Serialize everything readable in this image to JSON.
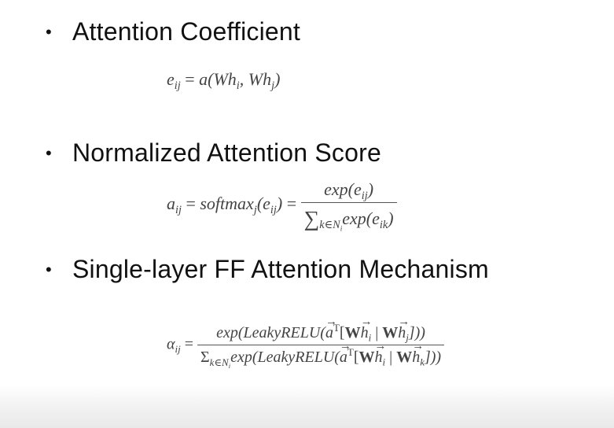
{
  "bullets": [
    {
      "symbol": "•",
      "text": "Attention Coefficient"
    },
    {
      "symbol": "•",
      "text": "Normalized Attention Score"
    },
    {
      "symbol": "•",
      "text": "Single-layer FF Attention Mechanism"
    }
  ],
  "eq1": {
    "lhs": "e",
    "lhs_sub": "ij",
    "rhs": "a(Wh",
    "arg1_sub": "i",
    "sep": ", Wh",
    "arg2_sub": "j",
    "close": ")",
    "equals": " = "
  },
  "eq2": {
    "lhs": "a",
    "lhs_sub": "ij",
    "equals": " = ",
    "softmax": "softmax",
    "softmax_sub": "j",
    "softmax_arg": "(e",
    "softmax_arg_sub": "ij",
    "softmax_close": ")",
    "equals2": " = ",
    "num": "exp(e",
    "num_sub": "ij",
    "num_close": ")",
    "den_sigma": "∑",
    "den_sigma_sub": "k∈N",
    "den_sigma_subsub": "i",
    "den": "exp(e",
    "den_sub": "ik",
    "den_close": ")"
  },
  "eq3": {
    "lhs": "α",
    "lhs_sub": "ij",
    "equals": " = ",
    "num_pre": "exp(LeakyRELU(",
    "vec_a": "a",
    "sup_T": "T",
    "bracket_open": "[",
    "W": "W",
    "vec_h": "h",
    "sub_i": "i",
    "pipe": " | ",
    "sub_j": "j",
    "num_post": "]))",
    "den_sigma": "Σ",
    "den_sigma_sub": "k∈N",
    "den_sigma_subsub": "i",
    "den_pre": "exp(LeakyRELU(",
    "sub_k": "k",
    "den_post": "]))"
  }
}
